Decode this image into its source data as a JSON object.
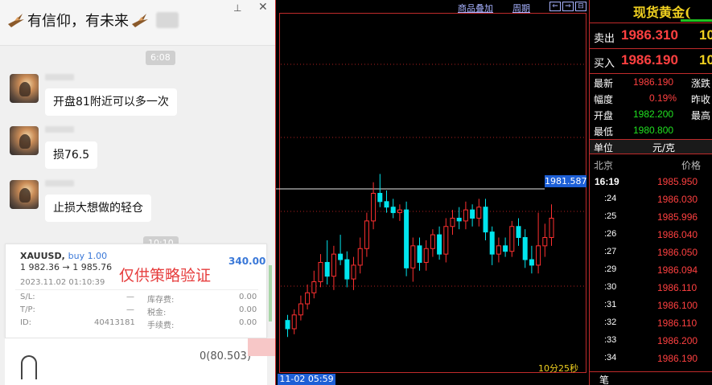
{
  "chat": {
    "title": "有信仰，有未来",
    "time1": "6:08",
    "messages": [
      {
        "text": "开盘81附近可以多一次"
      },
      {
        "text": "损76.5"
      },
      {
        "text": "止损大想做的轻仓"
      }
    ],
    "time2": "10:10",
    "trade_card": {
      "symbol": "XAUUSD,",
      "side": "buy 1.00",
      "profit": "340.00",
      "price_path": "1 982.36 → 1 985.76",
      "stamp": "仅供策略验证",
      "datetime": "2023.11.02 01:10:39",
      "sl_label": "S/L:",
      "sl_value": "—",
      "tp_label": "T/P:",
      "tp_value": "—",
      "id_label": "ID:",
      "id_value": "40413181",
      "swap_label": "库存费:",
      "swap_value": "0.00",
      "tax_label": "税金:",
      "tax_value": "0.00",
      "fee_label": "手续费:",
      "fee_value": "0.00"
    },
    "footer_value": "0(80.503)"
  },
  "chart": {
    "toolbar": {
      "overlay_label": "商品叠加",
      "period_label": "周期"
    },
    "last_price": "1981.587",
    "cursor_time": "11-02 05:59",
    "countdown": "10分25秒",
    "colors": {
      "up": "#ff3030",
      "down": "#00e5ee",
      "grid": "#b02020"
    }
  },
  "chart_data": {
    "type": "candlestick",
    "candles": [
      {
        "o": 1980.9,
        "h": 1981.1,
        "l": 1980.3,
        "c": 1980.6
      },
      {
        "o": 1980.6,
        "h": 1981.3,
        "l": 1980.4,
        "c": 1981.1
      },
      {
        "o": 1981.1,
        "h": 1981.8,
        "l": 1980.9,
        "c": 1981.5
      },
      {
        "o": 1981.5,
        "h": 1982.2,
        "l": 1981.3,
        "c": 1981.9
      },
      {
        "o": 1981.9,
        "h": 1982.7,
        "l": 1981.7,
        "c": 1982.3
      },
      {
        "o": 1982.3,
        "h": 1983.3,
        "l": 1982.1,
        "c": 1983.0
      },
      {
        "o": 1983.0,
        "h": 1983.8,
        "l": 1982.2,
        "c": 1982.5
      },
      {
        "o": 1982.5,
        "h": 1983.6,
        "l": 1982.0,
        "c": 1983.3
      },
      {
        "o": 1983.3,
        "h": 1984.0,
        "l": 1982.9,
        "c": 1983.1
      },
      {
        "o": 1983.1,
        "h": 1983.4,
        "l": 1982.1,
        "c": 1982.4
      },
      {
        "o": 1982.4,
        "h": 1983.2,
        "l": 1982.0,
        "c": 1982.9
      },
      {
        "o": 1982.9,
        "h": 1983.9,
        "l": 1982.6,
        "c": 1983.5
      },
      {
        "o": 1983.5,
        "h": 1984.8,
        "l": 1983.2,
        "c": 1984.5
      },
      {
        "o": 1984.5,
        "h": 1985.9,
        "l": 1984.2,
        "c": 1985.5
      },
      {
        "o": 1985.5,
        "h": 1986.2,
        "l": 1985.0,
        "c": 1985.2
      },
      {
        "o": 1985.2,
        "h": 1985.6,
        "l": 1984.8,
        "c": 1985.0
      },
      {
        "o": 1985.0,
        "h": 1985.3,
        "l": 1984.6,
        "c": 1984.8
      },
      {
        "o": 1984.8,
        "h": 1985.1,
        "l": 1984.5,
        "c": 1984.9
      },
      {
        "o": 1984.9,
        "h": 1985.2,
        "l": 1982.5,
        "c": 1982.8
      },
      {
        "o": 1982.8,
        "h": 1983.9,
        "l": 1982.3,
        "c": 1983.6
      },
      {
        "o": 1983.6,
        "h": 1983.9,
        "l": 1982.7,
        "c": 1983.0
      },
      {
        "o": 1983.0,
        "h": 1983.8,
        "l": 1982.7,
        "c": 1983.5
      },
      {
        "o": 1983.5,
        "h": 1984.2,
        "l": 1983.2,
        "c": 1984.0
      },
      {
        "o": 1984.0,
        "h": 1984.3,
        "l": 1983.1,
        "c": 1983.3
      },
      {
        "o": 1983.3,
        "h": 1984.6,
        "l": 1983.0,
        "c": 1984.3
      },
      {
        "o": 1984.3,
        "h": 1984.9,
        "l": 1984.0,
        "c": 1984.6
      },
      {
        "o": 1984.6,
        "h": 1985.0,
        "l": 1984.2,
        "c": 1984.5
      },
      {
        "o": 1984.5,
        "h": 1985.2,
        "l": 1984.2,
        "c": 1984.9
      },
      {
        "o": 1984.9,
        "h": 1985.1,
        "l": 1984.3,
        "c": 1984.6
      },
      {
        "o": 1984.6,
        "h": 1985.3,
        "l": 1984.3,
        "c": 1985.0
      },
      {
        "o": 1985.0,
        "h": 1985.3,
        "l": 1983.8,
        "c": 1984.1
      },
      {
        "o": 1984.1,
        "h": 1984.3,
        "l": 1982.9,
        "c": 1983.3
      },
      {
        "o": 1983.3,
        "h": 1983.9,
        "l": 1983.0,
        "c": 1983.6
      },
      {
        "o": 1983.6,
        "h": 1983.9,
        "l": 1983.2,
        "c": 1983.4
      },
      {
        "o": 1983.4,
        "h": 1984.5,
        "l": 1983.2,
        "c": 1984.3
      },
      {
        "o": 1984.3,
        "h": 1984.6,
        "l": 1983.6,
        "c": 1983.9
      },
      {
        "o": 1983.9,
        "h": 1984.2,
        "l": 1982.8,
        "c": 1983.1
      },
      {
        "o": 1983.1,
        "h": 1983.6,
        "l": 1982.6,
        "c": 1982.9
      },
      {
        "o": 1982.9,
        "h": 1984.8,
        "l": 1982.6,
        "c": 1983.6
      },
      {
        "o": 1983.6,
        "h": 1984.4,
        "l": 1983.2,
        "c": 1983.9
      },
      {
        "o": 1983.9,
        "h": 1985.1,
        "l": 1983.6,
        "c": 1984.6
      }
    ],
    "ylim": [
      1979.0,
      1992.0
    ],
    "grid": true
  },
  "quote": {
    "title": "现货黄金(",
    "sell_label": "卖出",
    "sell_price": "1986.310",
    "sell_extra": "10",
    "buy_label": "买入",
    "buy_price": "1986.190",
    "buy_extra": "10",
    "latest_label": "最新",
    "latest_value": "1986.190",
    "change_label": "涨跌",
    "amp_label": "幅度",
    "amp_value": "0.19%",
    "prevclose_label": "昨收",
    "open_label": "开盘",
    "open_value": "1982.200",
    "high_label": "最高",
    "low_label": "最低",
    "low_value": "1980.800",
    "unit_label": "单位",
    "unit_value": "元/克",
    "beijing_label": "北京",
    "price_label": "价格",
    "ticks": [
      {
        "time": "16:19",
        "price": "1985.950"
      },
      {
        "time": ":24",
        "price": "1986.030"
      },
      {
        "time": ":25",
        "price": "1985.996"
      },
      {
        "time": ":26",
        "price": "1986.040"
      },
      {
        "time": ":27",
        "price": "1986.050"
      },
      {
        "time": ":29",
        "price": "1986.094"
      },
      {
        "time": ":30",
        "price": "1986.110"
      },
      {
        "time": ":31",
        "price": "1986.100"
      },
      {
        "time": ":32",
        "price": "1986.110"
      },
      {
        "time": ":33",
        "price": "1986.200"
      },
      {
        "time": ":34",
        "price": "1986.190"
      }
    ],
    "bottom_label": "笔"
  }
}
